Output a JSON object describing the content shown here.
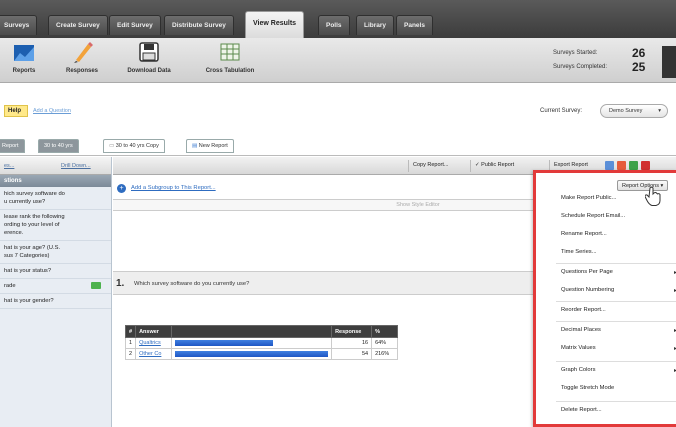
{
  "nav": {
    "tabs": [
      "Surveys",
      "Create Survey",
      "Edit Survey",
      "Distribute Survey",
      "View Results",
      "Polls",
      "Library",
      "Panels"
    ],
    "active_tab": "View Results"
  },
  "toolbar": {
    "reports": "Reports",
    "responses": "Responses",
    "download": "Download Data",
    "crosstab": "Cross Tabulation",
    "started_label": "Surveys Started:",
    "started_value": "26",
    "completed_label": "Surveys Completed:",
    "completed_value": "25"
  },
  "help": {
    "help_label": "Help",
    "add_question": "Add a Question",
    "current_survey_label": "Current Survey:",
    "current_survey_value": "Demo Survey"
  },
  "report_tabs": [
    "Report",
    "30 to 40 yrs",
    "30 to 40 yrs Copy",
    "New Report"
  ],
  "report_bar": {
    "copy": "Copy Report...",
    "public": "Public Report",
    "export": "Export Report"
  },
  "sidebar": {
    "left_link": "es...",
    "drill_down": "Drill Down...",
    "header": "stions",
    "items": [
      "hich survey software do\nu currently use?",
      "lease rank the following\nording to your level of\nerence.",
      "hat is your age? (U.S.\nsus 7 Categories)",
      "hat is your status?",
      "rade",
      "hat is your gender?"
    ]
  },
  "main": {
    "add_subgroup": "Add a Subgroup to This Report...",
    "style_editor": "Show Style Editor",
    "question_number": "1.",
    "question_text": "Which survey software do you currently use?",
    "table": {
      "headers": [
        "#",
        "Answer",
        "",
        "Response",
        "%"
      ],
      "rows": [
        {
          "n": "1",
          "answer": "Qualtrics",
          "response": "16",
          "pct": "64%",
          "bar_fraction": 0.64
        },
        {
          "n": "2",
          "answer": "Other Co",
          "response": "54",
          "pct": "216%",
          "bar_fraction": 1.0
        }
      ]
    }
  },
  "menu": {
    "button": "Report Options",
    "items": [
      "Make Report Public...",
      "Schedule Report Email...",
      "Rename Report...",
      "Time Series...",
      "Questions Per Page",
      "Question Numbering",
      "Reorder Report...",
      "Decimal Places",
      "Matrix Values",
      "Graph Colors",
      "Toggle Stretch Mode",
      "Delete Report..."
    ]
  },
  "colors": {
    "menu_border": "#e23a3a",
    "bar_blue": "#1e56c4",
    "help_yellow": "#ffe98a"
  }
}
